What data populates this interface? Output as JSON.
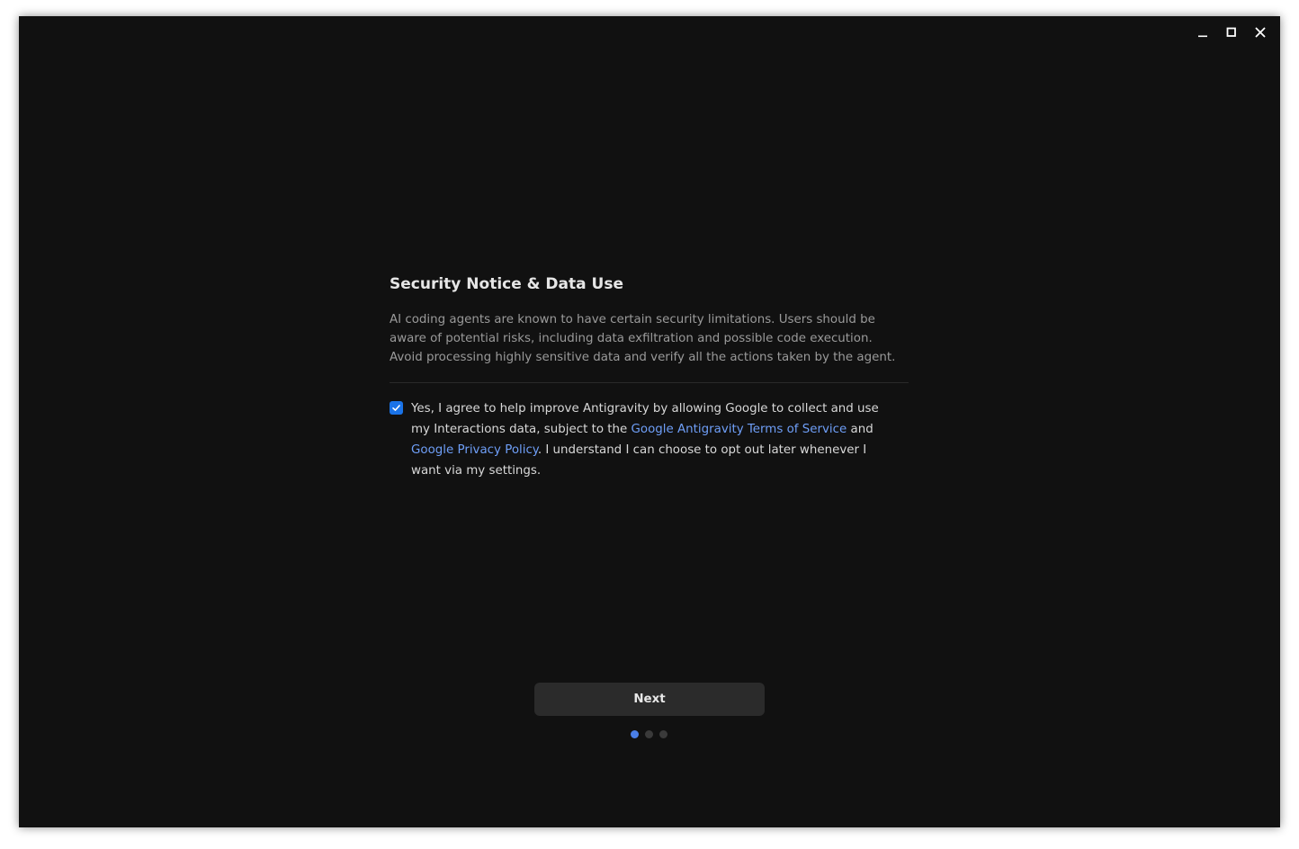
{
  "window": {
    "controls": {
      "minimize_icon": "minimize-icon",
      "maximize_icon": "maximize-icon",
      "close_icon": "close-icon"
    }
  },
  "notice": {
    "title": "Security Notice & Data Use",
    "description": "AI coding agents are known to have certain security limitations. Users should be aware of potential risks, including data exfiltration and possible code execution. Avoid processing highly sensitive data and verify all the actions taken by the agent."
  },
  "consent": {
    "checked": true,
    "text_part1": "Yes, I agree to help improve Antigravity by allowing Google to collect and use my Interactions data, subject to the ",
    "terms_link": "Google Antigravity Terms of Service",
    "text_part2": " and ",
    "privacy_link": "Google Privacy Policy",
    "text_part3": ". I understand I can choose to opt out later whenever I want via my settings."
  },
  "footer": {
    "next_label": "Next",
    "pagination": {
      "total": 3,
      "current": 1
    }
  },
  "colors": {
    "background": "#111111",
    "accent": "#1a73e8",
    "link": "#6f9ff8",
    "active_dot": "#4a7fe8",
    "inactive_dot": "#3a3a3a"
  }
}
